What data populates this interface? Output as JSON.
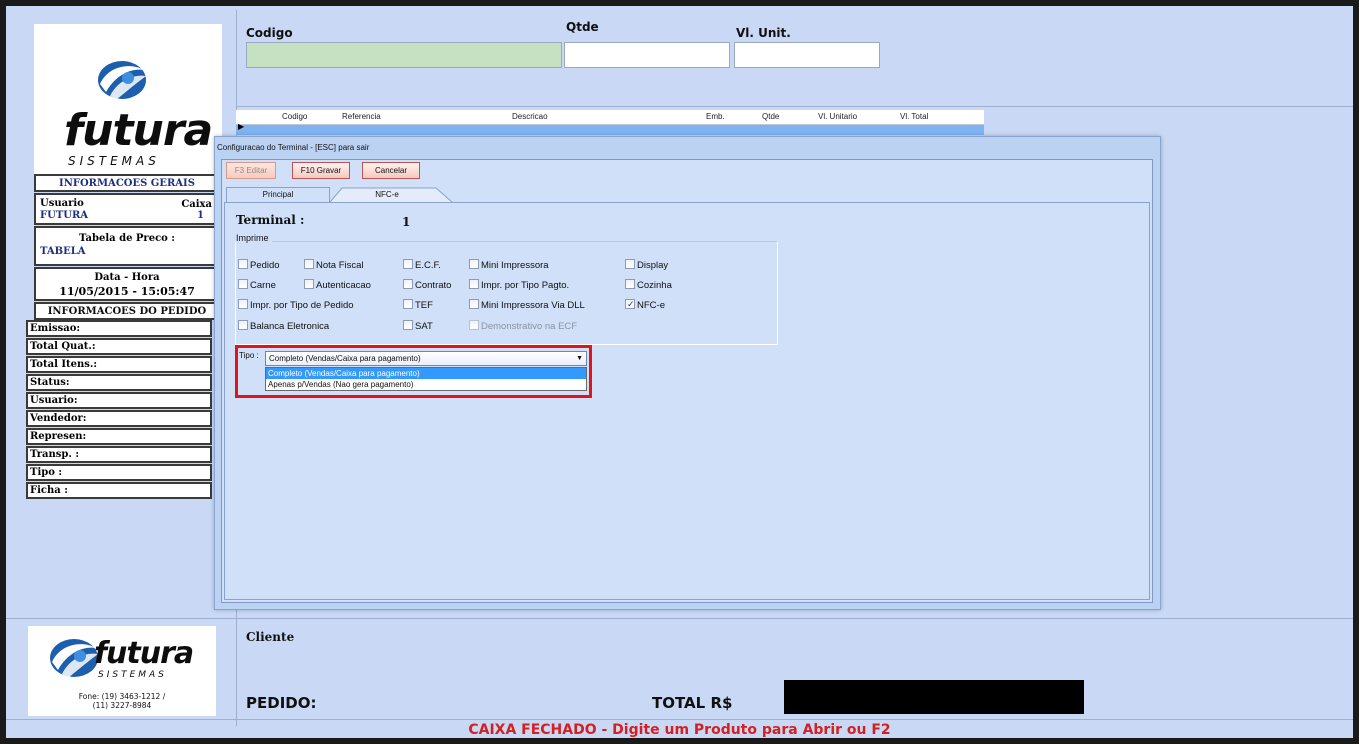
{
  "top": {
    "codigo_label": "Codigo",
    "qtde_label": "Qtde",
    "vl_unit_label": "Vl. Unit.",
    "codigo_value": "",
    "qtde_value": "",
    "vl_unit_value": ""
  },
  "grid": {
    "columns": [
      "Codigo",
      "Referencia",
      "Descricao",
      "Emb.",
      "Qtde",
      "Vl. Unitario",
      "Vl. Total"
    ],
    "row_marker": "▶"
  },
  "left": {
    "logo_word": "futura",
    "logo_sub": "SISTEMAS",
    "info_gerais_title": "INFORMACOES GERAIS",
    "usuario_label": "Usuario",
    "usuario_value": "FUTURA",
    "caixa_label": "Caixa",
    "caixa_value": "1",
    "tabela_preco_label": "Tabela de Preco :",
    "tabela_preco_value": "TABELA",
    "data_hora_label": "Data - Hora",
    "data_hora_value": "11/05/2015 - 15:05:47",
    "info_pedido_title": "INFORMACOES DO PEDIDO",
    "pedido_rows": [
      "Emissao:",
      "Total Quat.:",
      "Total Itens.:",
      "Status:",
      "Usuario:",
      "Vendedor:",
      "Represen:",
      "Transp. :",
      "Tipo :",
      "Ficha :"
    ]
  },
  "dialog": {
    "title": "Configuracao do Terminal - [ESC] para sair",
    "btn_editar": "F3 Editar",
    "btn_gravar": "F10 Gravar",
    "btn_cancelar": "Cancelar",
    "tab_principal": "Principal",
    "tab_nfce": "NFC-e",
    "terminal_label": "Terminal :",
    "terminal_value": "1",
    "imprime_label": "Imprime",
    "checkboxes": {
      "pedido": "Pedido",
      "nota_fiscal": "Nota Fiscal",
      "ecf": "E.C.F.",
      "mini_impressora": "Mini Impressora",
      "display": "Display",
      "carne": "Carne",
      "autenticacao": "Autenticacao",
      "contrato": "Contrato",
      "impr_tipo_pagto": "Impr. por Tipo Pagto.",
      "cozinha": "Cozinha",
      "impr_tipo_pedido": "Impr. por Tipo de Pedido",
      "tef": "TEF",
      "mini_impressora_dll": "Mini Impressora Via DLL",
      "nfce": "NFC-e",
      "balanca": "Balanca Eletronica",
      "sat": "SAT",
      "demonstrativo": "Demonstrativo na ECF"
    },
    "checked": {
      "nfce": true
    },
    "tipo_label": "Tipo :",
    "tipo_selected": "Completo (Vendas/Caixa para pagamento)",
    "tipo_options": [
      "Completo (Vendas/Caixa para pagamento)",
      "Apenas p/Vendas (Nao gera pagamento)"
    ]
  },
  "bottom": {
    "cliente_label": "Cliente",
    "pedido_label": "PEDIDO:",
    "total_label": "TOTAL R$",
    "fone_line1": "Fone: (19) 3463-1212 /",
    "fone_line2": "(11) 3227-8984",
    "status_text": "CAIXA FECHADO - Digite um Produto para Abrir ou F2"
  },
  "colors": {
    "background": "#c9d9f5",
    "highlight_border": "#e0141c",
    "status_text": "#d42020",
    "selected_option": "#3399ff"
  }
}
